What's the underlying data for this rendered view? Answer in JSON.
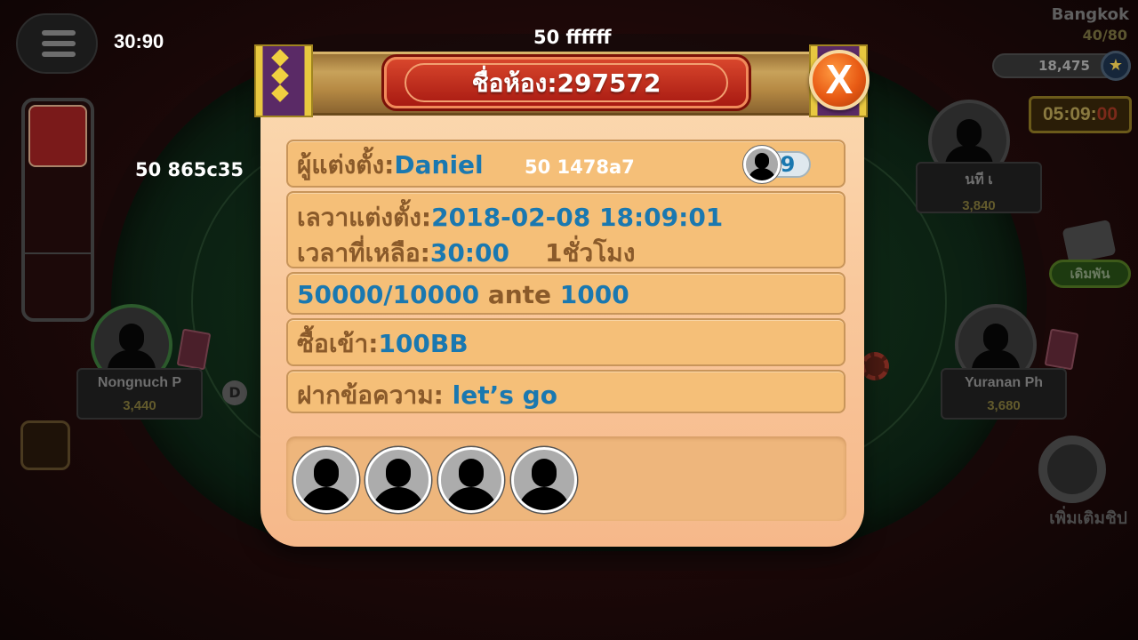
{
  "hud": {
    "timer": "30:90",
    "debug_top": "50 ffffff",
    "debug_left": "50 865c35",
    "city": "Bangkok",
    "player_count": "40/80",
    "chips": "18,475",
    "clock_main": "05:09:",
    "clock_secs": "00",
    "dice_label": "เดิมพัน",
    "add_chips_label": "เพิ่มเติมชิป",
    "dealer_marker": "D"
  },
  "seats": [
    {
      "name": "นที เ",
      "chips": "3,840"
    },
    {
      "name": "Nongnuch P",
      "chips": "3,440"
    },
    {
      "name": "Yuranan Ph",
      "chips": "3,680"
    }
  ],
  "dialog": {
    "title": "ชื่อห้อง:297572",
    "close_label": "X",
    "host_label": "ผู้แต่งตั้ง:",
    "host_name": "Daniel",
    "debug_inline": "50 1478a7",
    "member_count": "9",
    "created_label": "เลวาแต่งตั้ง:",
    "created_value": "2018-02-08 18:09:01",
    "remaining_label": "เวลาที่เหลือ:",
    "remaining_value": "30:00",
    "duration_value": "1ชั่วโมง",
    "blinds_value": "50000/10000",
    "ante_label": "ante",
    "ante_value": "1000",
    "buyin_label": "ซื้อเข้า:",
    "buyin_value": "100BB",
    "message_label": "ฝากข้อความ:",
    "message_value": "let’s go"
  },
  "colors": {
    "value_blue": "#1a78b0",
    "label_brown": "#8a5a2a",
    "title_red": "#b0201a",
    "close_orange": "#e85a14"
  }
}
